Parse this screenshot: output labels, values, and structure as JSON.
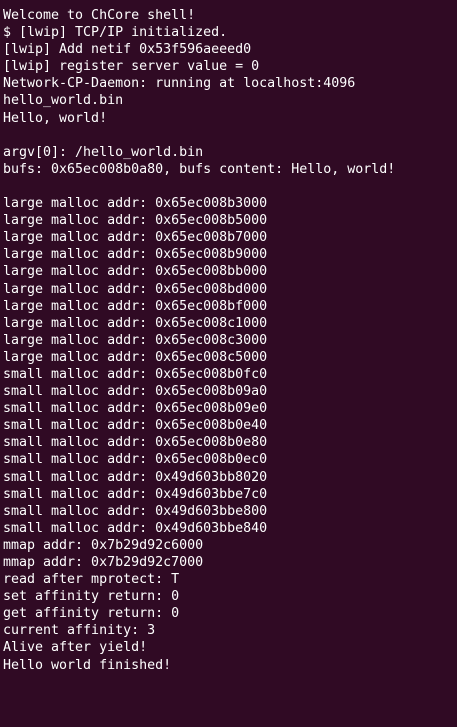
{
  "terminal": {
    "background": "#300a24",
    "foreground": "#ffffff",
    "lines": [
      "Welcome to ChCore shell!",
      "$ [lwip] TCP/IP initialized.",
      "[lwip] Add netif 0x53f596aeeed0",
      "[lwip] register server value = 0",
      "Network-CP-Daemon: running at localhost:4096",
      "hello_world.bin",
      "Hello, world!",
      "",
      "argv[0]: /hello_world.bin",
      "bufs: 0x65ec008b0a80, bufs content: Hello, world!",
      "",
      "large malloc addr: 0x65ec008b3000",
      "large malloc addr: 0x65ec008b5000",
      "large malloc addr: 0x65ec008b7000",
      "large malloc addr: 0x65ec008b9000",
      "large malloc addr: 0x65ec008bb000",
      "large malloc addr: 0x65ec008bd000",
      "large malloc addr: 0x65ec008bf000",
      "large malloc addr: 0x65ec008c1000",
      "large malloc addr: 0x65ec008c3000",
      "large malloc addr: 0x65ec008c5000",
      "small malloc addr: 0x65ec008b0fc0",
      "small malloc addr: 0x65ec008b09a0",
      "small malloc addr: 0x65ec008b09e0",
      "small malloc addr: 0x65ec008b0e40",
      "small malloc addr: 0x65ec008b0e80",
      "small malloc addr: 0x65ec008b0ec0",
      "small malloc addr: 0x49d603bb8020",
      "small malloc addr: 0x49d603bbe7c0",
      "small malloc addr: 0x49d603bbe800",
      "small malloc addr: 0x49d603bbe840",
      "mmap addr: 0x7b29d92c6000",
      "mmap addr: 0x7b29d92c7000",
      "read after mprotect: T",
      "set affinity return: 0",
      "get affinity return: 0",
      "current affinity: 3",
      "Alive after yield!",
      "Hello world finished!"
    ]
  }
}
